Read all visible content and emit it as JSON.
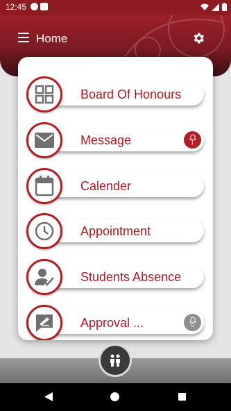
{
  "status_bar": {
    "time": "12:45"
  },
  "header": {
    "title": "Home"
  },
  "menu": [
    {
      "label": "Board Of Honours",
      "icon": "grid-icon"
    },
    {
      "label": "Message",
      "icon": "envelope-icon",
      "badge": "1"
    },
    {
      "label": "Calender",
      "icon": "calendar-icon"
    },
    {
      "label": "Appointment",
      "icon": "clock-icon"
    },
    {
      "label": "Students Absence",
      "icon": "student-check-icon"
    },
    {
      "label": "Approval ...",
      "icon": "signature-icon",
      "badge": "0"
    }
  ],
  "colors": {
    "primary": "#b01e26",
    "header_dark": "#7b1a22",
    "icon_grey": "#6f6f6f"
  }
}
